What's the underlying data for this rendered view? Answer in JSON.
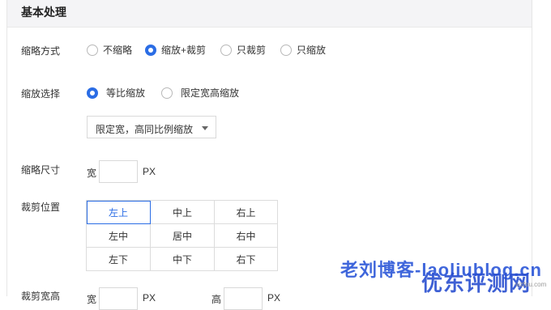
{
  "panel": {
    "title": "基本处理"
  },
  "thumb_mode": {
    "label": "缩略方式",
    "options": [
      "不缩略",
      "缩放+裁剪",
      "只裁剪",
      "只缩放"
    ],
    "selected": "缩放+裁剪"
  },
  "scale_select": {
    "label": "缩放选择",
    "options": [
      "等比缩放",
      "限定宽高缩放"
    ],
    "selected": "等比缩放"
  },
  "dropdown": {
    "value": "限定宽，高同比例缩放"
  },
  "thumb_size": {
    "label": "缩略尺寸",
    "width_prefix": "宽",
    "width_value": "",
    "unit": "PX"
  },
  "crop_position": {
    "label": "裁剪位置",
    "cells": [
      "左上",
      "中上",
      "右上",
      "左中",
      "居中",
      "右中",
      "左下",
      "中下",
      "右下"
    ],
    "selected": "左上"
  },
  "crop_size": {
    "label": "裁剪宽高",
    "width_prefix": "宽",
    "height_prefix": "高",
    "unit": "PX"
  },
  "watermark": {
    "text": "老刘博客-laoliublog.cn",
    "site": "优东评测网",
    "site_url": "wzfou.com"
  },
  "colors": {
    "accent": "#2b6de5",
    "header_bg": "#f4f4f6"
  }
}
